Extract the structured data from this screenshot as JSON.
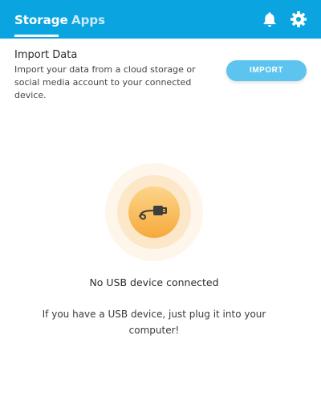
{
  "header": {
    "tabs": [
      {
        "label": "Storage",
        "active": true
      },
      {
        "label": "Apps",
        "active": false
      }
    ],
    "icons": [
      "bell-icon",
      "gear-icon"
    ],
    "background_color": "#0aa4e0"
  },
  "import": {
    "title": "Import Data",
    "description": "Import your data from a cloud storage or social media account to your connected device.",
    "button_label": "IMPORT",
    "button_color": "#5cc4ef"
  },
  "empty_state": {
    "icon": "usb-icon",
    "title": "No USB device connected",
    "description": "If you have a USB device, just plug it into your computer!",
    "accent_color": "#f8b64a"
  }
}
